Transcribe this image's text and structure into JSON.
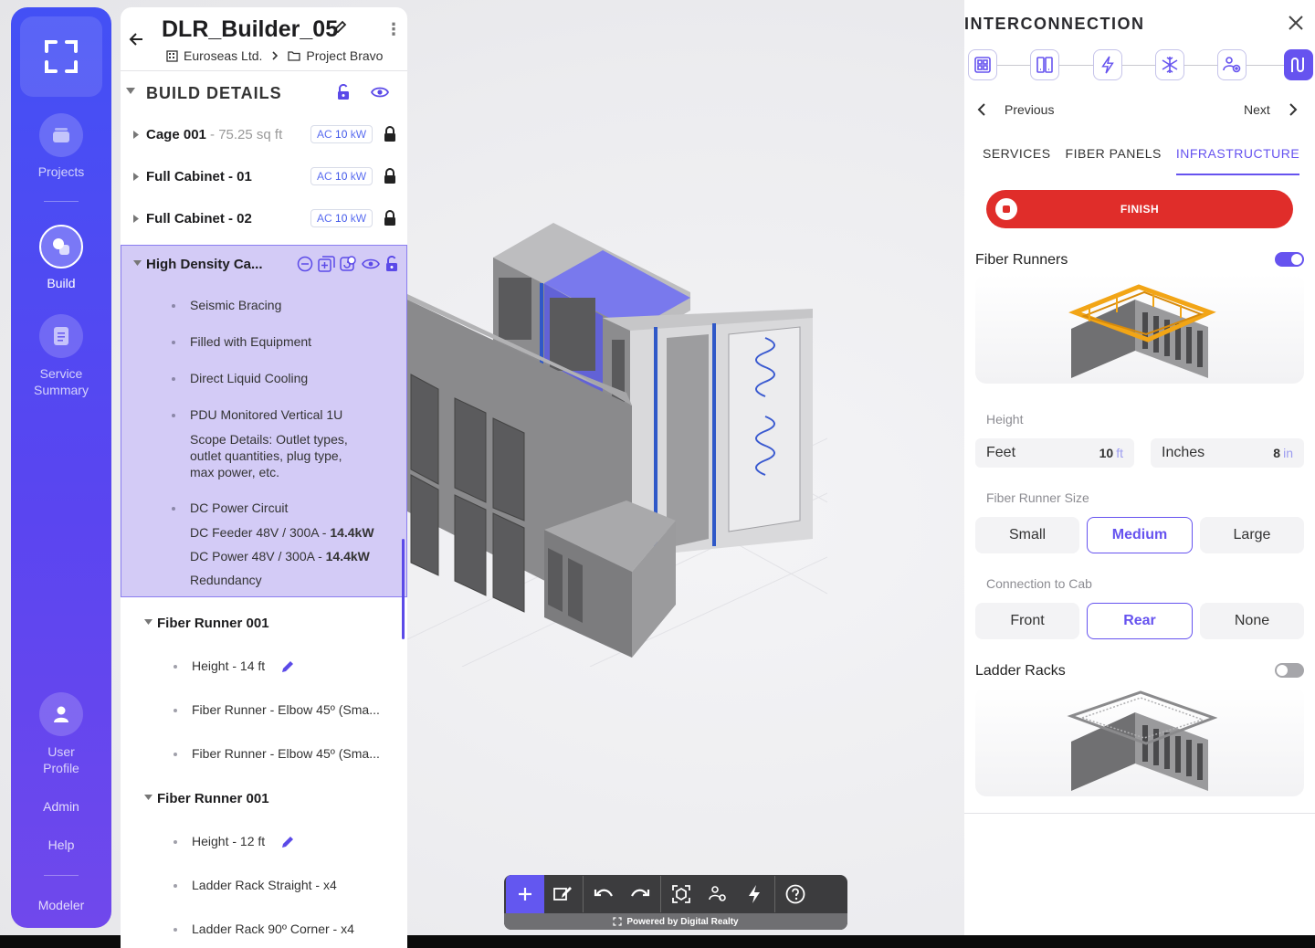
{
  "nav": {
    "items": [
      {
        "label": "Projects",
        "icon": "stack-icon"
      },
      {
        "label": "Build",
        "icon": "shapes-icon"
      },
      {
        "label": "Service Summary",
        "icon": "document-icon"
      },
      {
        "label": "User Profile",
        "icon": "user-icon"
      }
    ],
    "admin": "Admin",
    "help": "Help",
    "modeler": "Modeler"
  },
  "project": {
    "title": "DLR_Builder_05",
    "company": "Euroseas Ltd.",
    "folder": "Project Bravo"
  },
  "build_details": {
    "title": "BUILD DETAILS",
    "rows": [
      {
        "label": "Cage 001",
        "sub": " - 75.25 sq ft",
        "badge_prefix": "AC",
        "badge_value": "10",
        "badge_unit": "kW"
      },
      {
        "label": "Full Cabinet  - 01",
        "sub": "",
        "badge_prefix": "AC",
        "badge_value": "10",
        "badge_unit": "kW"
      },
      {
        "label": "Full Cabinet  - 02",
        "sub": "",
        "badge_prefix": "AC",
        "badge_value": "10",
        "badge_unit": "kW"
      }
    ],
    "hd": {
      "label": "High Density Ca...",
      "items": [
        "Seismic Bracing",
        "Filled with Equipment",
        "Direct Liquid Cooling",
        "PDU Monitored Vertical 1U",
        "Scope Details: Outlet types,",
        "outlet quantities, plug type,",
        "max power, etc.",
        "DC Power Circuit",
        "DC Feeder 48V / 300A - ",
        "14.4kW",
        "DC Power 48V / 300A - ",
        "14.4kW",
        "Redundancy"
      ]
    },
    "fiber_runner_1": {
      "label": "Fiber Runner 001",
      "items": [
        "Height - 14 ft",
        "Fiber Runner - Elbow  45º (Sma...",
        "Fiber Runner - Elbow  45º (Sma..."
      ]
    },
    "fiber_runner_2": {
      "label": "Fiber Runner 001",
      "items": [
        "Height - 12 ft",
        "Ladder Rack Straight - x4",
        "Ladder Rack 90º Corner - x4"
      ]
    }
  },
  "toolbar": {
    "footer": "Powered by Digital Realty"
  },
  "interconnection": {
    "title": "INTERCONNECTION",
    "steps": [
      "grid-icon",
      "cabinet-icon",
      "power-icon",
      "cooling-icon",
      "settings-people-icon",
      "interconnect-icon"
    ],
    "active_step": 5,
    "previous": "Previous",
    "next": "Next",
    "tabs": [
      "SERVICES",
      "FIBER PANELS",
      "INFRASTRUCTURE"
    ],
    "active_tab": 2,
    "finish": "FINISH",
    "fiber_runners": {
      "title": "Fiber Runners",
      "enabled": true,
      "height_label": "Height",
      "feet_label": "Feet",
      "feet_value": "10",
      "feet_unit": "ft",
      "inches_label": "Inches",
      "inches_value": "8",
      "inches_unit": "in",
      "size_label": "Fiber Runner Size",
      "sizes": [
        "Small",
        "Medium",
        "Large"
      ],
      "selected_size": "Medium",
      "connection_label": "Connection to Cab",
      "connections": [
        "Front",
        "Rear",
        "None"
      ],
      "selected_connection": "Rear"
    },
    "ladder_racks": {
      "title": "Ladder Racks",
      "enabled": false
    }
  },
  "colors": {
    "accent": "#6653ef",
    "finish": "#e02d2a",
    "highlight": "#d3cbf6"
  }
}
